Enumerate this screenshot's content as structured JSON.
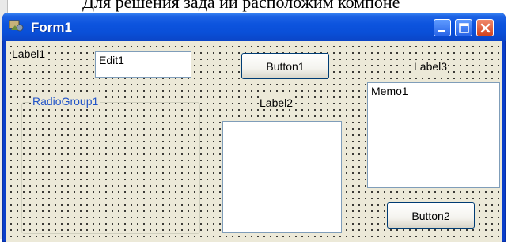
{
  "document": {
    "heading_fragment": "Для решения зада ий расположим компоне"
  },
  "window": {
    "title": "Form1",
    "icon": "delphi-form-icon",
    "controls": {
      "minimize": "minimize-icon",
      "maximize": "maximize-icon",
      "close": "close-icon"
    }
  },
  "form": {
    "label1": "Label1",
    "edit1": "Edit1",
    "button1": "Button1",
    "label2": "Label2",
    "label3": "Label3",
    "memo1": "Memo1",
    "button2": "Button2",
    "radiogroup1": "RadioGroup1"
  },
  "colors": {
    "titlebar": "#0a4fd8",
    "client": "#ece9d8",
    "close_button": "#d4431e"
  }
}
